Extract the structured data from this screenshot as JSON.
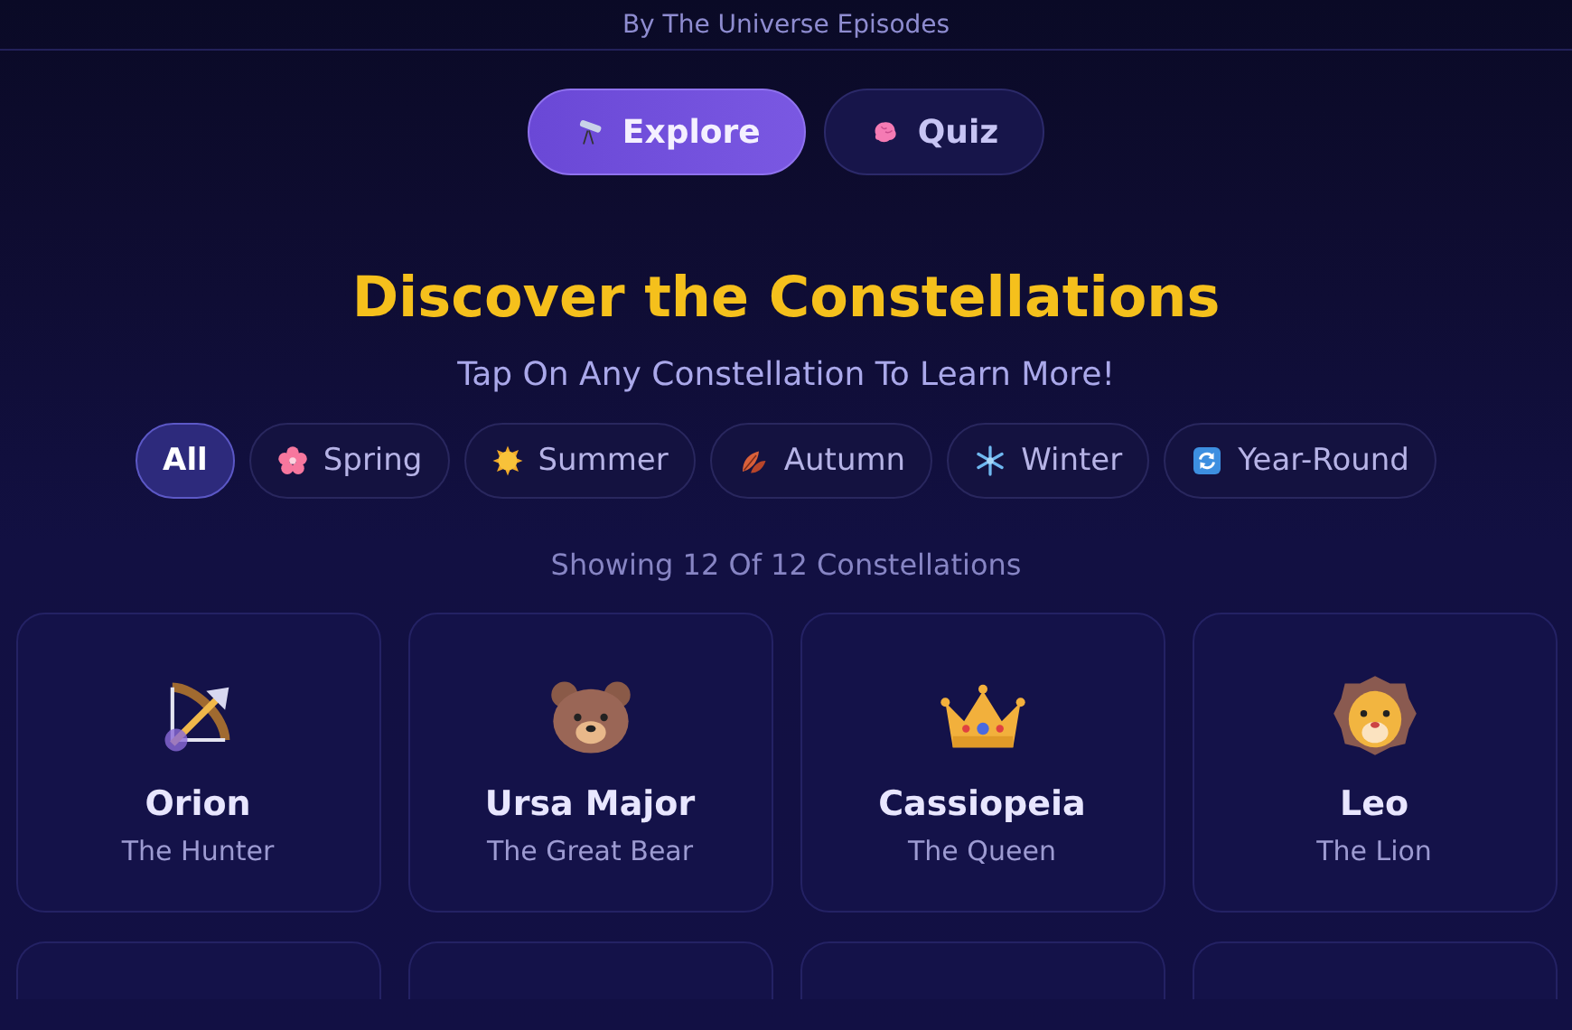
{
  "header": {
    "byline": "By The Universe Episodes"
  },
  "tabs": [
    {
      "label": "Explore",
      "selected": true
    },
    {
      "label": "Quiz",
      "selected": false
    }
  ],
  "title": "Discover the Constellations",
  "subtitle": "Tap On Any Constellation To Learn More!",
  "filters": [
    {
      "label": "All",
      "selected": true
    },
    {
      "label": "Spring",
      "selected": false
    },
    {
      "label": "Summer",
      "selected": false
    },
    {
      "label": "Autumn",
      "selected": false
    },
    {
      "label": "Winter",
      "selected": false
    },
    {
      "label": "Year-Round",
      "selected": false
    }
  ],
  "count_text": "Showing 12 Of 12 Constellations",
  "constellations": [
    {
      "name": "Orion",
      "subtitle": "The Hunter"
    },
    {
      "name": "Ursa Major",
      "subtitle": "The Great Bear"
    },
    {
      "name": "Cassiopeia",
      "subtitle": "The Queen"
    },
    {
      "name": "Leo",
      "subtitle": "The Lion"
    }
  ]
}
